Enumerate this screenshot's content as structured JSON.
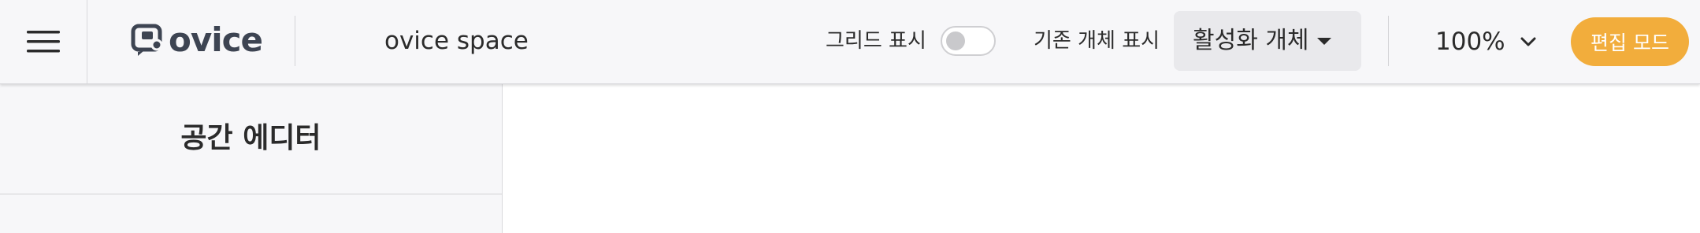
{
  "header": {
    "menu_icon": "hamburger-menu-icon",
    "logo_text": "ovice",
    "space_name": "ovice space",
    "grid_toggle": {
      "label": "그리드 표시",
      "on": false
    },
    "legacy_objects": {
      "label": "기존 개체 표시",
      "selected": "활성화 개체"
    },
    "zoom": "100%",
    "edit_mode_label": "편집 모드",
    "edit_mode_color": "#f2ad3c"
  },
  "sidebar": {
    "title": "공간 에디터"
  }
}
